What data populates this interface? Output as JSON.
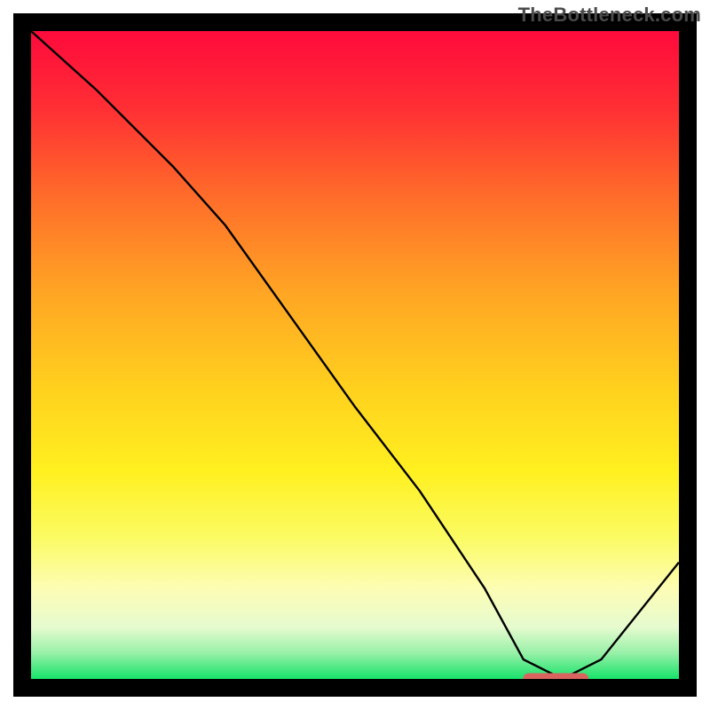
{
  "watermark": "TheBottleneck.com",
  "colors": {
    "frame": "#000000",
    "curve": "#000000",
    "marker_fill": "#d9635e",
    "marker_stroke": "#d9635e",
    "grad0": "#ff0a3c",
    "grad12": "#ff2f34",
    "grad25": "#ff6a2a",
    "grad40": "#ffa424",
    "grad55": "#ffd01e",
    "grad68": "#fff020",
    "grad78": "#fbfb62",
    "grad86": "#fdfdb4",
    "grad92": "#e6fbcf",
    "grad96": "#98f0a8",
    "grad100": "#17e36a"
  },
  "chart_data": {
    "type": "line",
    "title": "",
    "xlabel": "",
    "ylabel": "",
    "xlim": [
      0,
      100
    ],
    "ylim": [
      0,
      100
    ],
    "note": "Axes have no visible tick labels; x and y are normalized 0–100. The curve is the black bottleneck trace; the marker is the optimal-region bar near the minimum.",
    "series": [
      {
        "name": "bottleneck-curve",
        "x": [
          0,
          10,
          22,
          30,
          40,
          50,
          60,
          70,
          76,
          82,
          88,
          100
        ],
        "y": [
          100,
          91,
          79,
          70,
          56,
          42,
          29,
          14,
          3,
          0,
          3,
          18
        ]
      }
    ],
    "optimal_marker": {
      "x_start": 76,
      "x_end": 86,
      "y": 0
    }
  }
}
